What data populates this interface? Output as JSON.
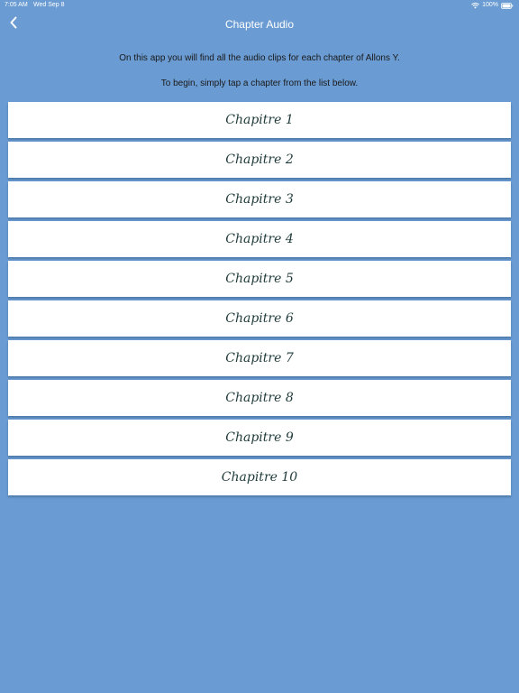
{
  "status_bar": {
    "time": "7:05 AM",
    "date": "Wed Sep 8",
    "battery": "100%",
    "icons": [
      "wifi-icon",
      "battery-icon"
    ]
  },
  "nav": {
    "title": "Chapter Audio",
    "back_icon": "chevron-left-icon"
  },
  "intro": {
    "line1": "On this app you will find all the audio clips for each chapter of Allons Y.",
    "line2": "To begin, simply tap a chapter from the list below."
  },
  "chapters": [
    {
      "label": "Chapitre 1"
    },
    {
      "label": "Chapitre 2"
    },
    {
      "label": "Chapitre 3"
    },
    {
      "label": "Chapitre 4"
    },
    {
      "label": "Chapitre 5"
    },
    {
      "label": "Chapitre 6"
    },
    {
      "label": "Chapitre 7"
    },
    {
      "label": "Chapitre 8"
    },
    {
      "label": "Chapitre 9"
    },
    {
      "label": "Chapitre 10"
    }
  ],
  "colors": {
    "background": "#6a9bd2",
    "button": "#ffffff",
    "chapter_text": "#1f3a3a"
  }
}
